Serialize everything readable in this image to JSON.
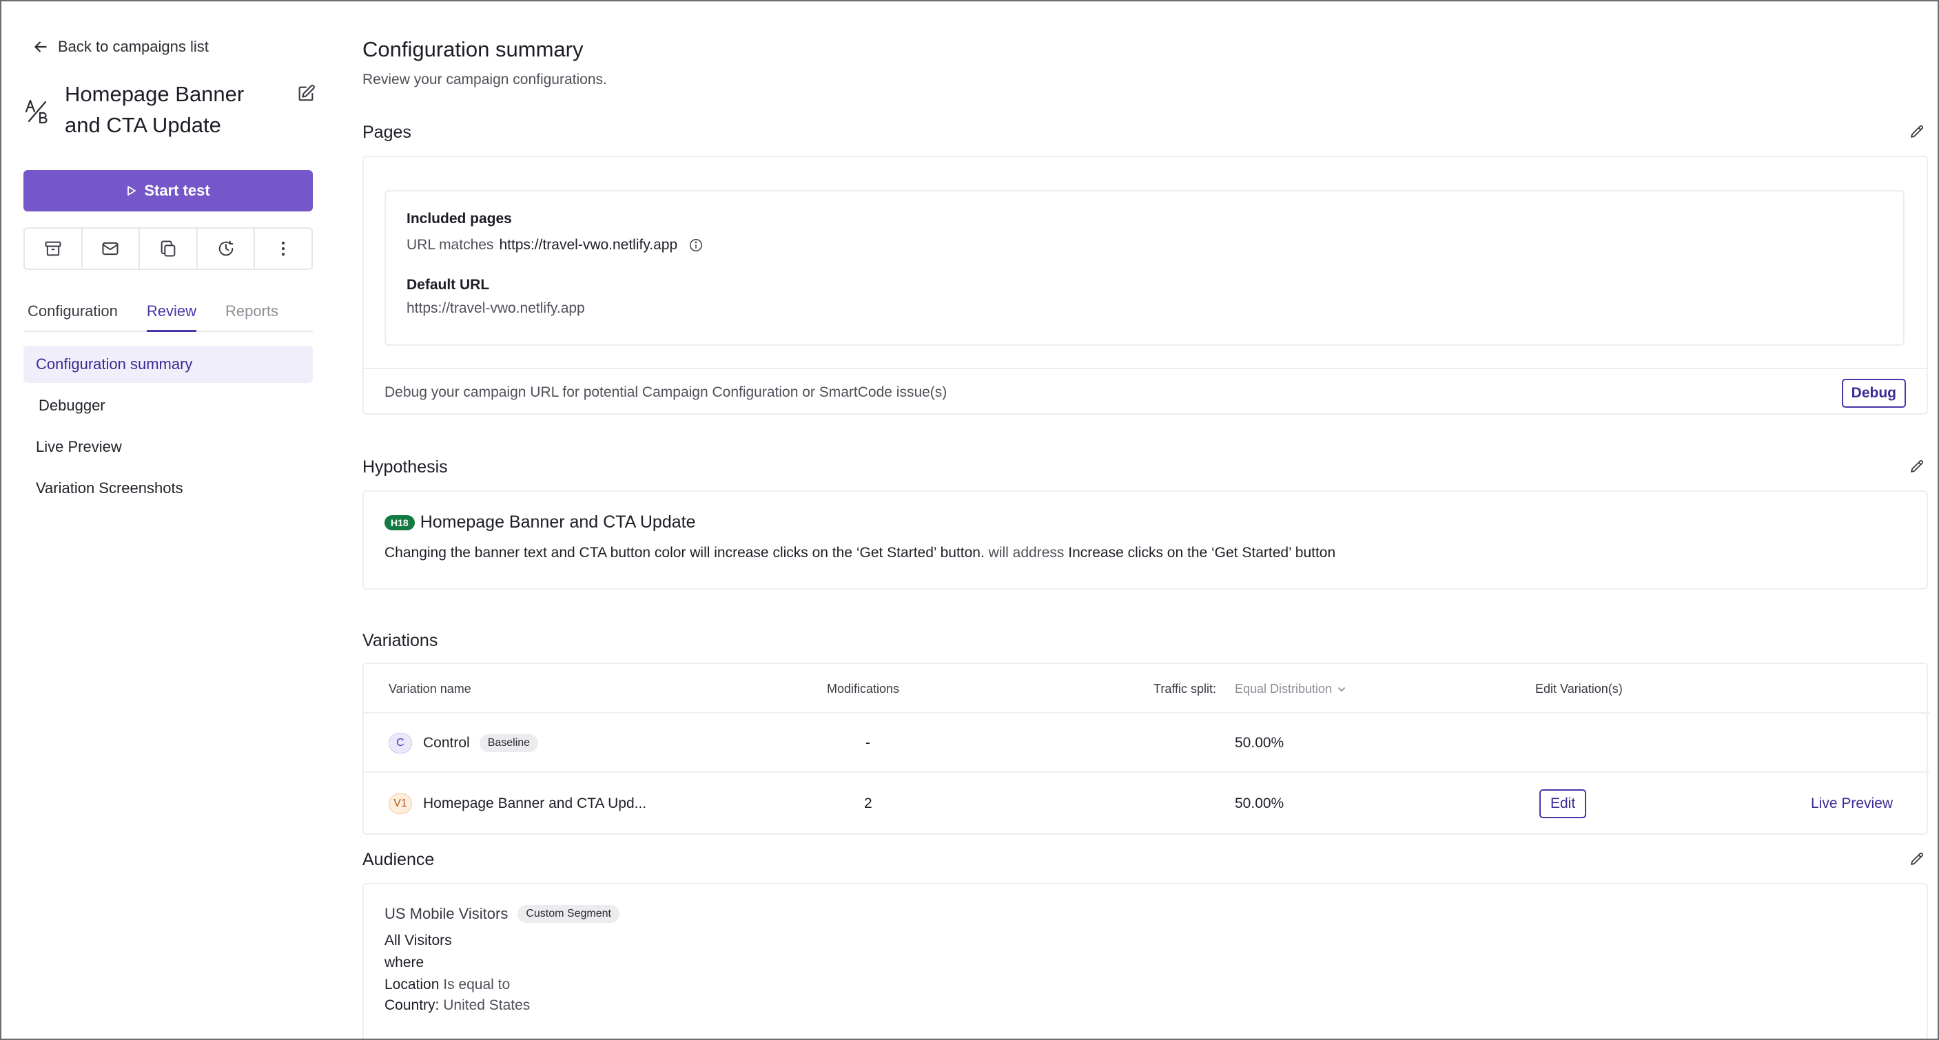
{
  "sidebar": {
    "back_label": "Back to campaigns list",
    "campaign_title": "Homepage Banner and CTA Update",
    "start_label": "Start test",
    "tabs": [
      {
        "label": "Configuration"
      },
      {
        "label": "Review"
      },
      {
        "label": "Reports"
      }
    ],
    "nav": [
      {
        "label": "Configuration summary"
      },
      {
        "label": "Debugger"
      },
      {
        "label": "Live Preview"
      },
      {
        "label": "Variation Screenshots"
      }
    ]
  },
  "main": {
    "title": "Configuration summary",
    "subtitle": "Review your campaign configurations.",
    "pages": {
      "title": "Pages",
      "included_label": "Included pages",
      "url_matches_prefix": "URL matches",
      "url_matches_value": "https://travel-vwo.netlify.app",
      "default_url_label": "Default URL",
      "default_url_value": "https://travel-vwo.netlify.app",
      "debug_text": "Debug your campaign URL for potential Campaign Configuration or SmartCode issue(s)",
      "debug_button": "Debug"
    },
    "hypothesis": {
      "title": "Hypothesis",
      "tag": "H18",
      "name": "Homepage Banner and CTA Update",
      "statement": "Changing the banner text and CTA button color will increase clicks on the ‘Get Started’ button.",
      "connector": "will address",
      "goal": "Increase clicks on the ‘Get Started’ button"
    },
    "variations": {
      "title": "Variations",
      "col_name": "Variation name",
      "col_mods": "Modifications",
      "col_traffic": "Traffic split:",
      "traffic_mode": "Equal Distribution",
      "col_edit": "Edit Variation(s)",
      "rows": [
        {
          "badge": "C",
          "name": "Control",
          "pill": "Baseline",
          "mods": "-",
          "traffic": "50.00%"
        },
        {
          "badge": "V1",
          "name": "Homepage Banner and CTA Upd...",
          "mods": "2",
          "traffic": "50.00%",
          "edit": "Edit",
          "preview": "Live Preview"
        }
      ]
    },
    "audience": {
      "title": "Audience",
      "segment_name": "US Mobile Visitors",
      "segment_tag": "Custom Segment",
      "line1": "All Visitors",
      "line2": "where",
      "cond_key": "Location",
      "cond_op": "Is equal to",
      "cond_field": "Country:",
      "cond_value": "United States"
    }
  },
  "colors": {
    "accent": "#7557c9",
    "accent_dark": "#3b2a94",
    "hyp_tag": "#137a43"
  }
}
